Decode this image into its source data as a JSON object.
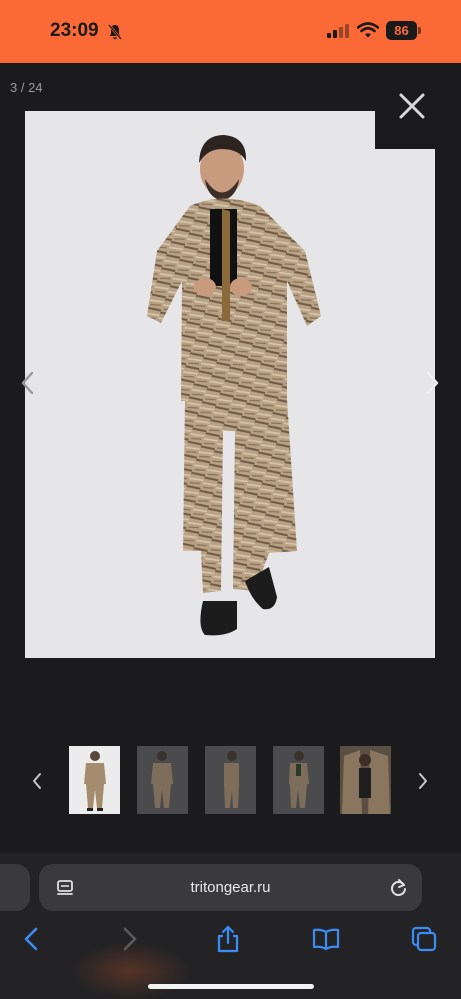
{
  "status_bar": {
    "time": "23:09",
    "battery": "86",
    "icons": [
      "bell-slash-icon",
      "cellular-signal-icon",
      "wifi-icon",
      "battery-icon"
    ],
    "background": "#fb6a36"
  },
  "gallery": {
    "counter": "3 / 24",
    "close_icon": "close-icon",
    "prev_icon": "chevron-left-icon",
    "next_icon": "chevron-right-icon",
    "main_image": "model-in-reed-camouflage-suit",
    "thumbnails": [
      {
        "name": "thumbnail-1",
        "active": true
      },
      {
        "name": "thumbnail-2",
        "active": false
      },
      {
        "name": "thumbnail-3",
        "active": false
      },
      {
        "name": "thumbnail-4",
        "active": false
      },
      {
        "name": "thumbnail-5",
        "active": false
      }
    ]
  },
  "browser": {
    "url": "tritongear.ru",
    "toolbar": [
      "back-icon",
      "forward-icon",
      "share-icon",
      "bookmarks-icon",
      "tabs-icon"
    ]
  }
}
